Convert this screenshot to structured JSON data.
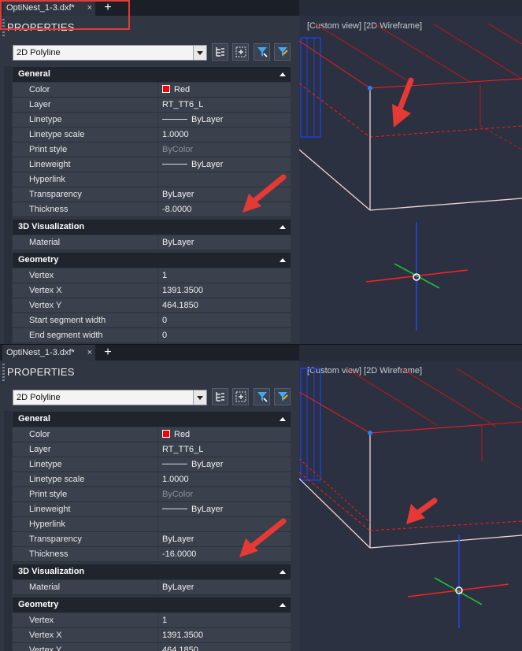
{
  "tab": {
    "name": "OptiNest_1-3.dxf*",
    "close": "×",
    "new": "+"
  },
  "panel": {
    "title": "PROPERTIES",
    "selector": "2D Polyline",
    "tools": [
      "tree-icon",
      "select-objects-icon",
      "quick-select-icon",
      "filter-icon"
    ]
  },
  "viewport": {
    "label": "[Custom view] [2D Wireframe]"
  },
  "sections": {
    "general": "General",
    "visualization": "3D Visualization",
    "geometry": "Geometry"
  },
  "labels": {
    "color": "Color",
    "layer": "Layer",
    "linetype": "Linetype",
    "linetype_scale": "Linetype scale",
    "print_style": "Print style",
    "lineweight": "Lineweight",
    "hyperlink": "Hyperlink",
    "transparency": "Transparency",
    "thickness": "Thickness",
    "material": "Material",
    "vertex": "Vertex",
    "vertex_x": "Vertex X",
    "vertex_y": "Vertex Y",
    "start_width": "Start segment width",
    "end_width": "End segment width"
  },
  "values": {
    "color": "Red",
    "layer": "RT_TT6_L",
    "linetype": "ByLayer",
    "linetype_scale": "1.0000",
    "print_style": "ByColor",
    "lineweight": "ByLayer",
    "hyperlink": "",
    "transparency": "ByLayer",
    "material": "ByLayer",
    "vertex": "1",
    "vertex_x": "1391.3500",
    "vertex_y": "464.1850",
    "start_width": "0",
    "end_width": "0"
  },
  "top": {
    "thickness": "-8.0000"
  },
  "bottom": {
    "thickness": "-16.0000"
  },
  "colors": {
    "entity_red": "#ff0000",
    "accent_arrow": "#e53935",
    "panel_bg": "#303642",
    "viewport_bg": "#2b3140"
  }
}
